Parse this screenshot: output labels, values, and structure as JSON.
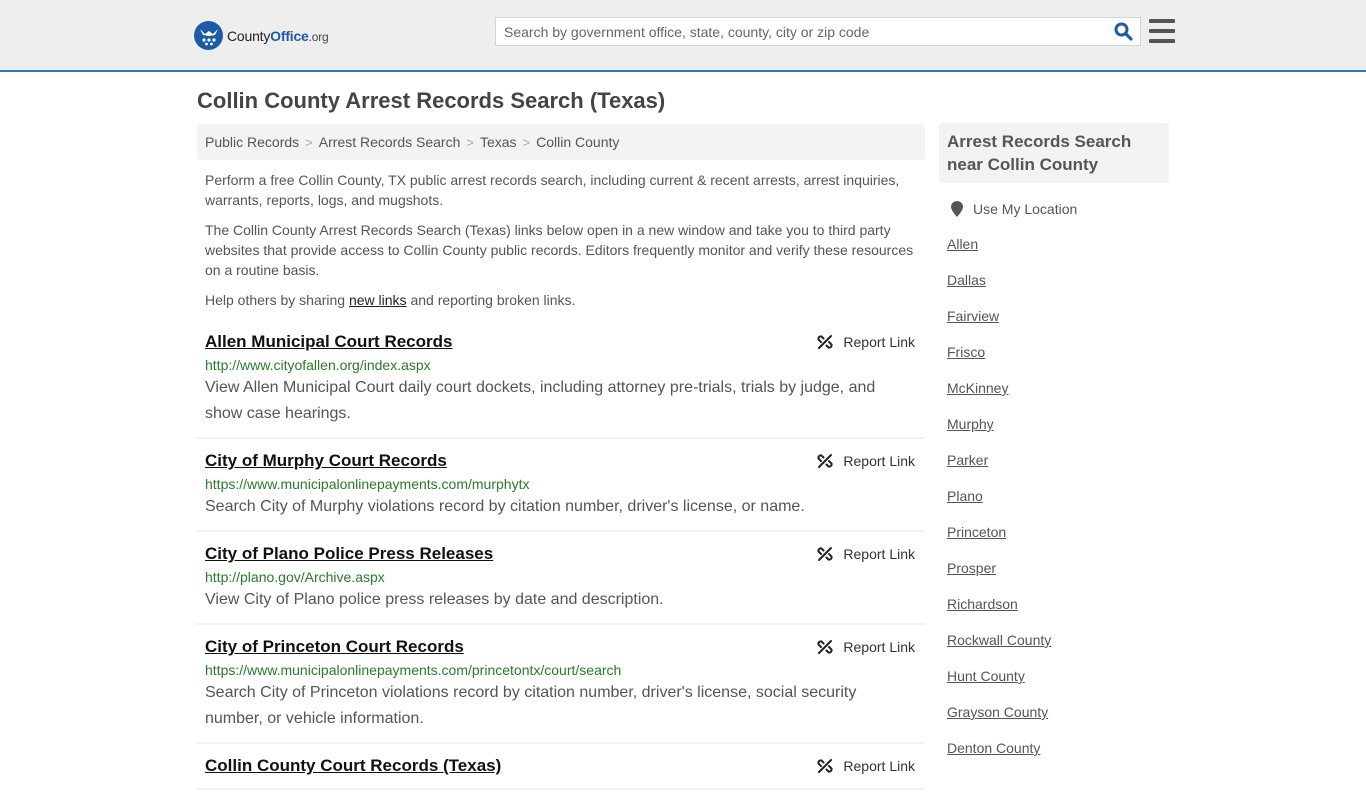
{
  "header": {
    "logo": {
      "name": "County",
      "brand": "Office",
      "tld": ".org"
    },
    "search": {
      "placeholder": "Search by government office, state, county, city or zip code",
      "value": ""
    },
    "colors": {
      "accent": "#3277b2",
      "brand": "#1f5aa6",
      "url_green": "#2a7a2a"
    }
  },
  "page": {
    "title": "Collin County Arrest Records Search (Texas)"
  },
  "breadcrumb": [
    {
      "label": "Public Records"
    },
    {
      "label": "Arrest Records Search"
    },
    {
      "label": "Texas"
    },
    {
      "label": "Collin County"
    }
  ],
  "intro": {
    "p1": "Perform a free Collin County, TX public arrest records search, including current & recent arrests, arrest inquiries, warrants, reports, logs, and mugshots.",
    "p2": "The Collin County Arrest Records Search (Texas) links below open in a new window and take you to third party websites that provide access to Collin County public records. Editors frequently monitor and verify these resources on a routine basis.",
    "p3_before": "Help others by sharing ",
    "p3_link": "new links",
    "p3_after": " and reporting broken links."
  },
  "report_label": "Report Link",
  "results": [
    {
      "title": "Allen Municipal Court Records",
      "url": "http://www.cityofallen.org/index.aspx",
      "desc": "View Allen Municipal Court daily court dockets, including attorney pre-trials, trials by judge, and show case hearings."
    },
    {
      "title": "City of Murphy Court Records",
      "url": "https://www.municipalonlinepayments.com/murphytx",
      "desc": "Search City of Murphy violations record by citation number, driver's license, or name."
    },
    {
      "title": "City of Plano Police Press Releases",
      "url": "http://plano.gov/Archive.aspx",
      "desc": "View City of Plano police press releases by date and description."
    },
    {
      "title": "City of Princeton Court Records",
      "url": "https://www.municipalonlinepayments.com/princetontx/court/search",
      "desc": "Search City of Princeton violations record by citation number, driver's license, social security number, or vehicle information."
    },
    {
      "title": "Collin County Court Records (Texas)",
      "url": "",
      "desc": ""
    }
  ],
  "sidebar": {
    "heading": "Arrest Records Search near Collin County",
    "use_location": "Use My Location",
    "nearby": [
      "Allen",
      "Dallas",
      "Fairview",
      "Frisco",
      "McKinney",
      "Murphy",
      "Parker",
      "Plano",
      "Princeton",
      "Prosper",
      "Richardson",
      "Rockwall County",
      "Hunt County",
      "Grayson County",
      "Denton County"
    ]
  }
}
